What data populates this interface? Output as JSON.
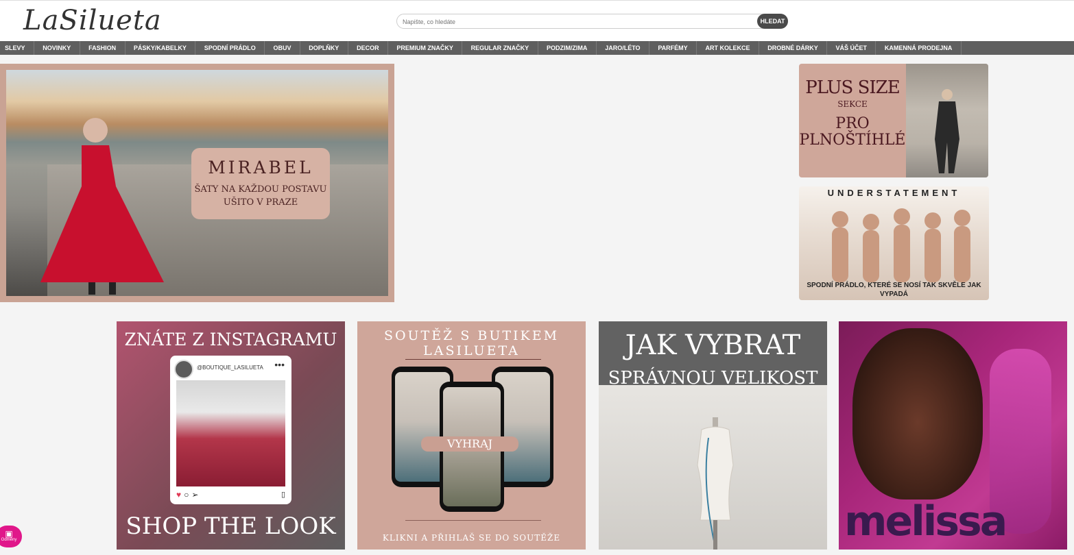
{
  "header": {
    "logo": "LaSilueta",
    "search": {
      "placeholder": "Napište, co hledáte",
      "button_label": "HLEDAT"
    }
  },
  "nav": {
    "items": [
      "SLEVY",
      "NOVINKY",
      "FASHION",
      "PÁSKY/KABELKY",
      "SPODNÍ PRÁDLO",
      "OBUV",
      "DOPLŇKY",
      "DECOR",
      "PREMIUM ZNAČKY",
      "REGULAR ZNAČKY",
      "PODZIM/ZIMA",
      "JARO/LÉTO",
      "PARFÉMY",
      "ART KOLEKCE",
      "DROBNÉ DÁRKY",
      "VÁŠ ÚČET",
      "KAMENNÁ PRODEJNA"
    ]
  },
  "hero": {
    "title": "MIRABEL",
    "line1": "ŠATY NA KAŽDOU POSTAVU",
    "line2": "UŠITO V PRAZE"
  },
  "plus_size": {
    "line1": "PLUS SIZE",
    "line2": "SEKCE",
    "line3": "PRO",
    "line4": "PLNOŠTÍHLÉ"
  },
  "understatement": {
    "title": "UNDERSTATEMENT",
    "subtitle": "SPODNÍ PRÁDLO, KTERÉ SE NOSÍ TAK SKVĚLE JAK VYPADÁ"
  },
  "instagram_tile": {
    "top": "ZNÁTE Z INSTAGRAMU",
    "handle": "@BOUTIQUE_LASILUETA",
    "bottom": "SHOP THE LOOK"
  },
  "soutez_tile": {
    "line1": "SOUTĚŽ S BUTIKEM",
    "line2": "LASILUETA",
    "badge": "VYHRAJ",
    "bottom": "KLIKNI A PŘIHLAŠ SE DO SOUTĚŽE"
  },
  "size_tile": {
    "line1": "JAK VYBRAT",
    "line2": "SPRÁVNOU VELIKOST"
  },
  "melissa_tile": {
    "logo": "melissa"
  },
  "floating_badge": {
    "label": "Odměny"
  },
  "colors": {
    "nav_bg": "#5f5f5f",
    "accent_pink": "#e0178a",
    "rose": "#cfa69a"
  }
}
